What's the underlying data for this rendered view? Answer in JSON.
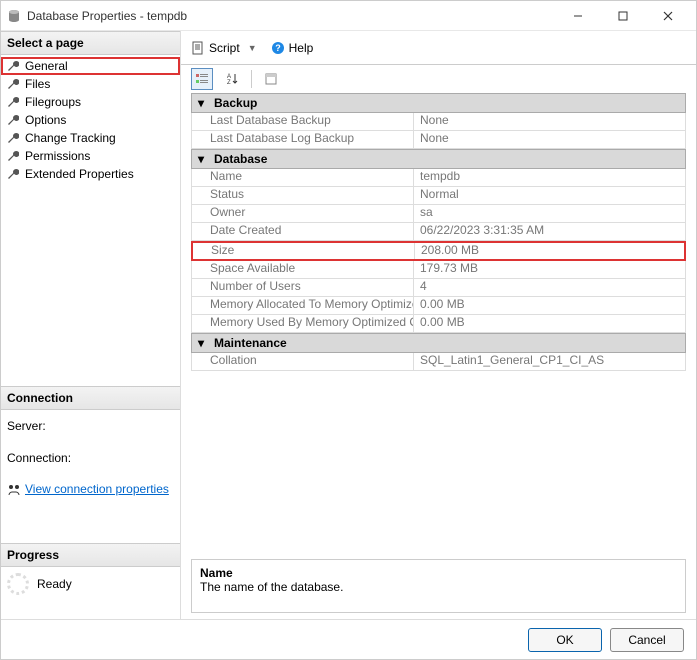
{
  "window": {
    "title": "Database Properties - tempdb"
  },
  "nav": {
    "select_page": "Select a page",
    "connection": "Connection",
    "progress": "Progress",
    "items": [
      {
        "label": "General",
        "selected": true
      },
      {
        "label": "Files"
      },
      {
        "label": "Filegroups"
      },
      {
        "label": "Options"
      },
      {
        "label": "Change Tracking"
      },
      {
        "label": "Permissions"
      },
      {
        "label": "Extended Properties"
      }
    ],
    "server_label": "Server:",
    "connection_label": "Connection:",
    "view_conn": "View connection properties",
    "ready": "Ready"
  },
  "toolbar": {
    "script": "Script",
    "help": "Help"
  },
  "grid": {
    "categories": [
      {
        "name": "Backup",
        "rows": [
          {
            "k": "Last Database Backup",
            "v": "None"
          },
          {
            "k": "Last Database Log Backup",
            "v": "None"
          }
        ]
      },
      {
        "name": "Database",
        "rows": [
          {
            "k": "Name",
            "v": "tempdb"
          },
          {
            "k": "Status",
            "v": "Normal"
          },
          {
            "k": "Owner",
            "v": "sa"
          },
          {
            "k": "Date Created",
            "v": "06/22/2023 3:31:35 AM"
          },
          {
            "k": "Size",
            "v": "208.00 MB",
            "hl": true
          },
          {
            "k": "Space Available",
            "v": "179.73 MB"
          },
          {
            "k": "Number of Users",
            "v": "4"
          },
          {
            "k": "Memory Allocated To Memory Optimized Obje",
            "v": "0.00 MB"
          },
          {
            "k": "Memory Used By Memory Optimized Objects",
            "v": "0.00 MB"
          }
        ]
      },
      {
        "name": "Maintenance",
        "rows": [
          {
            "k": "Collation",
            "v": "SQL_Latin1_General_CP1_CI_AS"
          }
        ]
      }
    ]
  },
  "desc": {
    "title": "Name",
    "body": "The name of the database."
  },
  "footer": {
    "ok": "OK",
    "cancel": "Cancel"
  }
}
